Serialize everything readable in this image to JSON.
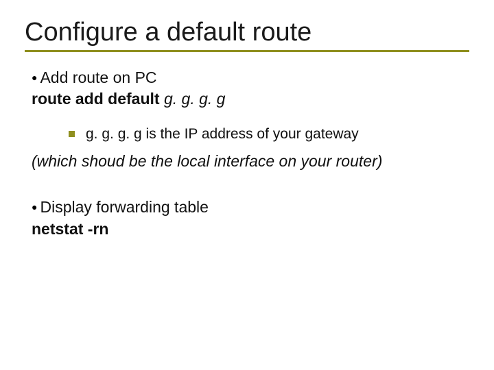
{
  "title": "Configure a default route",
  "section1": {
    "bullet": "Add route on PC",
    "cmd_fixed": "route add default ",
    "cmd_arg": "g. g. g. g",
    "sub": "g. g. g. g is the IP address of your gateway",
    "note": "(which shoud be the local interface on your router)"
  },
  "section2": {
    "bullet": "Display forwarding table",
    "cmd_fixed": "netstat -rn"
  },
  "glyphs": {
    "dot": "●"
  }
}
